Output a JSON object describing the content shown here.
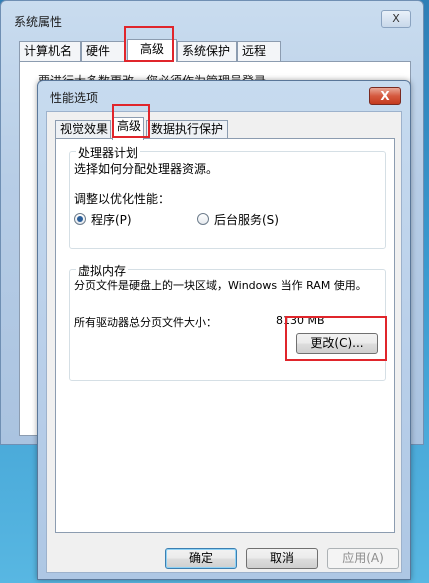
{
  "back_window": {
    "title": "系统属性",
    "close_glyph": "X",
    "tabs": [
      "计算机名",
      "硬件",
      "高级",
      "系统保护",
      "远程"
    ],
    "active_tab": 2,
    "partial_text": "要进行大多数更改，您必须作为管理员登录。"
  },
  "dialog": {
    "title": "性能选项",
    "close_glyph": "X",
    "tabs": [
      "视觉效果",
      "高级",
      "数据执行保护"
    ],
    "active_tab": 1,
    "processor": {
      "legend": "处理器计划",
      "desc": "选择如何分配处理器资源。",
      "adjust_label": "调整以优化性能：",
      "option_programs": "程序(P)",
      "option_services": "后台服务(S)",
      "selected": "programs"
    },
    "virtual_memory": {
      "legend": "虚拟内存",
      "desc": "分页文件是硬盘上的一块区域，Windows 当作 RAM 使用。",
      "total_label": "所有驱动器总分页文件大小：",
      "total_value": "8130 MB",
      "change_button": "更改(C)..."
    },
    "buttons": {
      "ok": "确定",
      "cancel": "取消",
      "apply": "应用(A)"
    }
  },
  "colors": {
    "highlight": "#e0252b",
    "close_red": "#c43b1f"
  }
}
